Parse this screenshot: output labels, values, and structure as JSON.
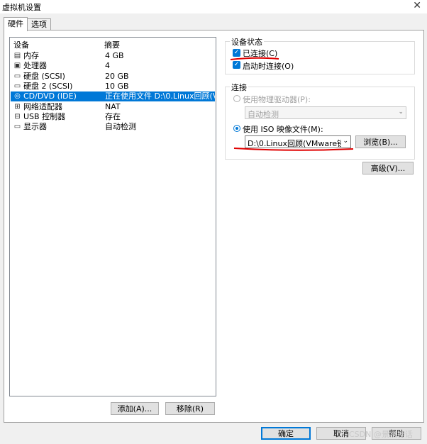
{
  "window": {
    "title": "虚拟机设置",
    "close_glyph": "✕"
  },
  "tabs": [
    {
      "label": "硬件",
      "active": true
    },
    {
      "label": "选项",
      "active": false
    }
  ],
  "device_list": {
    "headers": {
      "device": "设备",
      "summary": "摘要"
    },
    "rows": [
      {
        "icon": "memory-icon",
        "glyph": "▤",
        "name": "内存",
        "summary": "4 GB"
      },
      {
        "icon": "processor-icon",
        "glyph": "▣",
        "name": "处理器",
        "summary": "4"
      },
      {
        "icon": "disk-icon",
        "glyph": "▭",
        "name": "硬盘 (SCSI)",
        "summary": "20 GB"
      },
      {
        "icon": "disk-icon",
        "glyph": "▭",
        "name": "硬盘 2 (SCSI)",
        "summary": "10 GB"
      },
      {
        "icon": "cd-icon",
        "glyph": "◎",
        "name": "CD/DVD (IDE)",
        "summary": "正在使用文件 D:\\0.Linux回顾(V...",
        "selected": true
      },
      {
        "icon": "network-icon",
        "glyph": "⊞",
        "name": "网络适配器",
        "summary": "NAT"
      },
      {
        "icon": "usb-icon",
        "glyph": "⊟",
        "name": "USB 控制器",
        "summary": "存在"
      },
      {
        "icon": "display-icon",
        "glyph": "▭",
        "name": "显示器",
        "summary": "自动检测"
      }
    ]
  },
  "left_buttons": {
    "add": "添加(A)...",
    "remove": "移除(R)"
  },
  "device_status": {
    "group_label": "设备状态",
    "connected": {
      "label": "已连接(C)",
      "checked": true
    },
    "connect_at_power_on": {
      "label": "启动时连接(O)",
      "checked": true
    }
  },
  "connection": {
    "group_label": "连接",
    "physical": {
      "label": "使用物理驱动器(P):",
      "selected": false,
      "combo_value": "自动检测"
    },
    "iso": {
      "label": "使用 ISO 映像文件(M):",
      "selected": true,
      "combo_value": "D:\\0.Linux回顾(VMware镜像"
    },
    "browse": "浏览(B)..."
  },
  "advanced": "高级(V)...",
  "footer": {
    "ok": "确定",
    "cancel": "取消",
    "help": "帮助"
  },
  "watermark": "CSDN @景黑神话",
  "accent_color": "#0078d7",
  "annotation_color": "#e00000"
}
